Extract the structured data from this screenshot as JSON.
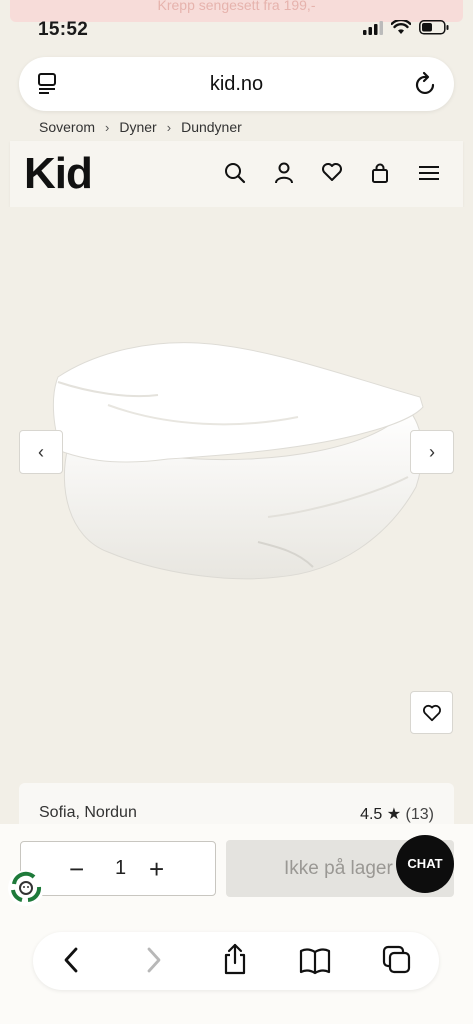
{
  "promo": {
    "text": "Krepp sengesett fra 199,-"
  },
  "status": {
    "time": "15:52"
  },
  "browser": {
    "url": "kid.no",
    "icons": {
      "reader": "reader-icon",
      "reload": "reload-icon"
    }
  },
  "breadcrumb": {
    "items": [
      "Soverom",
      "Dyner",
      "Dundyner"
    ]
  },
  "header": {
    "logo": "Kid",
    "icons": [
      "search-icon",
      "user-icon",
      "heart-icon",
      "bag-icon",
      "menu-icon"
    ]
  },
  "gallery": {
    "prev_label": "‹",
    "next_label": "›",
    "image": "white-down-duvet"
  },
  "product": {
    "name": "Sofia, Nordun",
    "rating": "4.5 ★",
    "review_count": "(13)"
  },
  "purchase": {
    "qty_minus": "−",
    "quantity": "1",
    "qty_plus": "+",
    "stock_label": "Ikke på lager",
    "chat_label": "CHAT"
  },
  "toolbar": {
    "icons": [
      "back-icon",
      "forward-icon",
      "share-icon",
      "bookmarks-icon",
      "tabs-icon"
    ]
  },
  "colors": {
    "background": "#f2efe7",
    "chat": "#0d0d0d",
    "disabled": "#e4e3df"
  }
}
